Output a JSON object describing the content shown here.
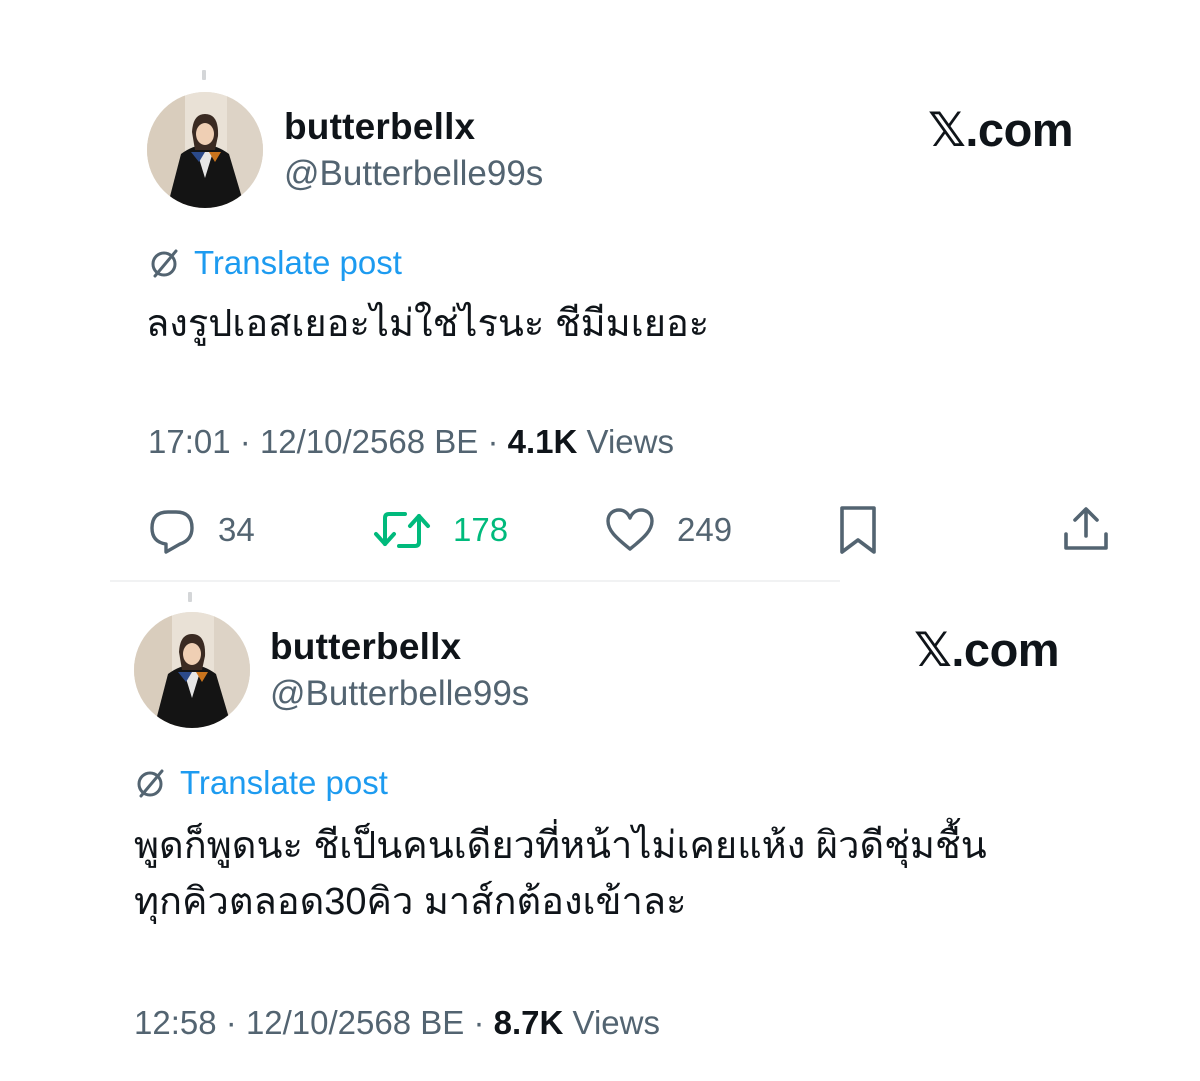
{
  "posts": [
    {
      "display_name": "butterbellx",
      "handle": "@Butterbelle99s",
      "brand": "𝕏.com",
      "translate_label": "Translate post",
      "text": "ลงรูปเอสเยอะไม่ใช่ไรนะ ชีมีมเยอะ",
      "time": "17:01",
      "date": "12/10/2568 BE",
      "views_count": "4.1K",
      "views_label": "Views",
      "replies": "34",
      "reposts": "178",
      "likes": "249"
    },
    {
      "display_name": "butterbellx",
      "handle": "@Butterbelle99s",
      "brand": "𝕏.com",
      "translate_label": "Translate post",
      "text": "พูดก็พูดนะ ชีเป็นคนเดียวที่หน้าไม่เคยแห้ง ผิวดีชุ่มชื้น\nทุกคิวตลอด30คิว มาส์กต้องเข้าละ",
      "time": "12:58",
      "date": "12/10/2568 BE",
      "views_count": "8.7K",
      "views_label": "Views"
    }
  ],
  "colors": {
    "text": "#0f1419",
    "secondary": "#536471",
    "link": "#1d9bf0",
    "repost_active": "#00ba7c"
  },
  "icons": {
    "translate": "translate-globe-icon",
    "reply": "reply-icon",
    "repost": "repost-icon",
    "like": "heart-icon",
    "bookmark": "bookmark-icon",
    "share": "share-icon"
  }
}
